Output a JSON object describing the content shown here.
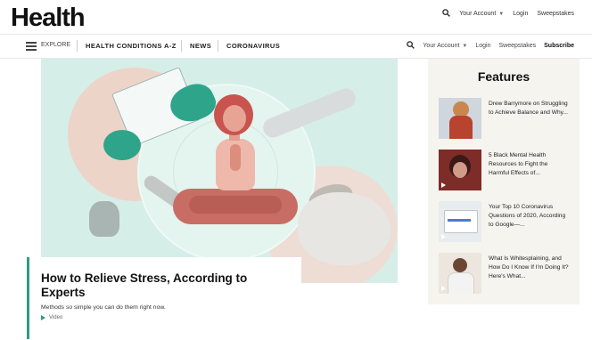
{
  "header": {
    "logo": "Health",
    "search_icon": "search-icon",
    "account_label": "Your Account",
    "login_label": "Login",
    "sweepstakes_label": "Sweepstakes"
  },
  "nav": {
    "menu_icon": "hamburger-menu-icon",
    "explore_label": "EXPLORE",
    "links": [
      "HEALTH CONDITIONS A-Z",
      "NEWS",
      "CORONAVIRUS"
    ],
    "account_label": "Your Account",
    "login_label": "Login",
    "sweepstakes_label": "Sweepstakes",
    "subscribe_label": "Subscribe"
  },
  "hero": {
    "title": "How to Relieve Stress, According to Experts",
    "subtitle": "Methods so simple you can do them right now.",
    "media_label": "Video"
  },
  "features": {
    "title": "Features",
    "items": [
      {
        "text": "Drew Barrymore on Struggling to Achieve Balance and Why..."
      },
      {
        "text": "5 Black Mental Health Resources to Fight the Harmful Effects of..."
      },
      {
        "text": "Your Top 10 Coronavirus Questions of 2020, According to Google—..."
      },
      {
        "text": "What Is Whitesplaining, and How Do I Know If I'm Doing It? Here's What..."
      }
    ]
  },
  "colors": {
    "accent": "#2d9c86",
    "hero_bg": "#d6eee8",
    "features_bg": "#f6f4ef"
  }
}
